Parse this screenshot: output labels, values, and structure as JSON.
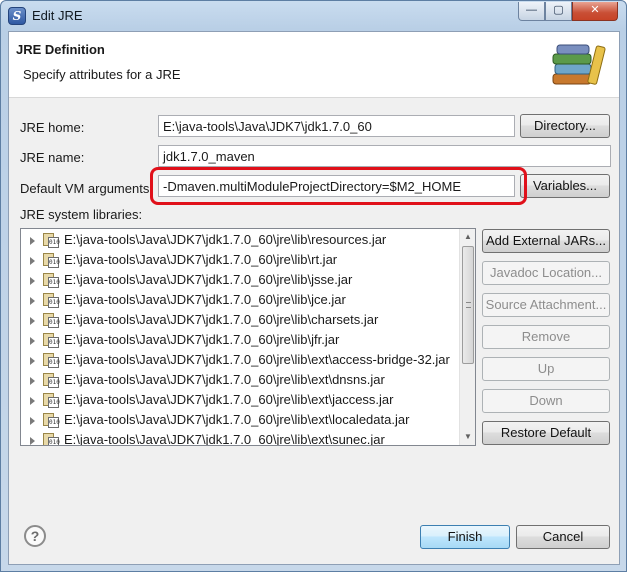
{
  "window": {
    "title": "Edit JRE",
    "minimize_glyph": "—",
    "maximize_glyph": "▢",
    "close_glyph": "✕"
  },
  "header": {
    "title": "JRE Definition",
    "description": "Specify attributes for a JRE"
  },
  "form": {
    "jre_home_label": "JRE home:",
    "jre_home_value": "E:\\java-tools\\Java\\JDK7\\jdk1.7.0_60",
    "directory_button": "Directory...",
    "jre_name_label": "JRE name:",
    "jre_name_value": "jdk1.7.0_maven",
    "vm_args_label": "Default VM arguments:",
    "vm_args_value": "-Dmaven.multiModuleProjectDirectory=$M2_HOME",
    "variables_button": "Variables...",
    "libraries_label": "JRE system libraries:"
  },
  "libraries": [
    "E:\\java-tools\\Java\\JDK7\\jdk1.7.0_60\\jre\\lib\\resources.jar",
    "E:\\java-tools\\Java\\JDK7\\jdk1.7.0_60\\jre\\lib\\rt.jar",
    "E:\\java-tools\\Java\\JDK7\\jdk1.7.0_60\\jre\\lib\\jsse.jar",
    "E:\\java-tools\\Java\\JDK7\\jdk1.7.0_60\\jre\\lib\\jce.jar",
    "E:\\java-tools\\Java\\JDK7\\jdk1.7.0_60\\jre\\lib\\charsets.jar",
    "E:\\java-tools\\Java\\JDK7\\jdk1.7.0_60\\jre\\lib\\jfr.jar",
    "E:\\java-tools\\Java\\JDK7\\jdk1.7.0_60\\jre\\lib\\ext\\access-bridge-32.jar",
    "E:\\java-tools\\Java\\JDK7\\jdk1.7.0_60\\jre\\lib\\ext\\dnsns.jar",
    "E:\\java-tools\\Java\\JDK7\\jdk1.7.0_60\\jre\\lib\\ext\\jaccess.jar",
    "E:\\java-tools\\Java\\JDK7\\jdk1.7.0_60\\jre\\lib\\ext\\localedata.jar",
    "E:\\java-tools\\Java\\JDK7\\jdk1.7.0_60\\jre\\lib\\ext\\sunec.jar"
  ],
  "library_buttons": {
    "add_external_jars": "Add External JARs...",
    "javadoc_location": "Javadoc Location...",
    "source_attachment": "Source Attachment...",
    "remove": "Remove",
    "up": "Up",
    "down": "Down",
    "restore_default": "Restore Default"
  },
  "footer": {
    "help_glyph": "?",
    "finish_button": "Finish",
    "cancel_button": "Cancel"
  },
  "colors": {
    "highlight": "#e0101a",
    "default_button": "#3c7fb1"
  }
}
